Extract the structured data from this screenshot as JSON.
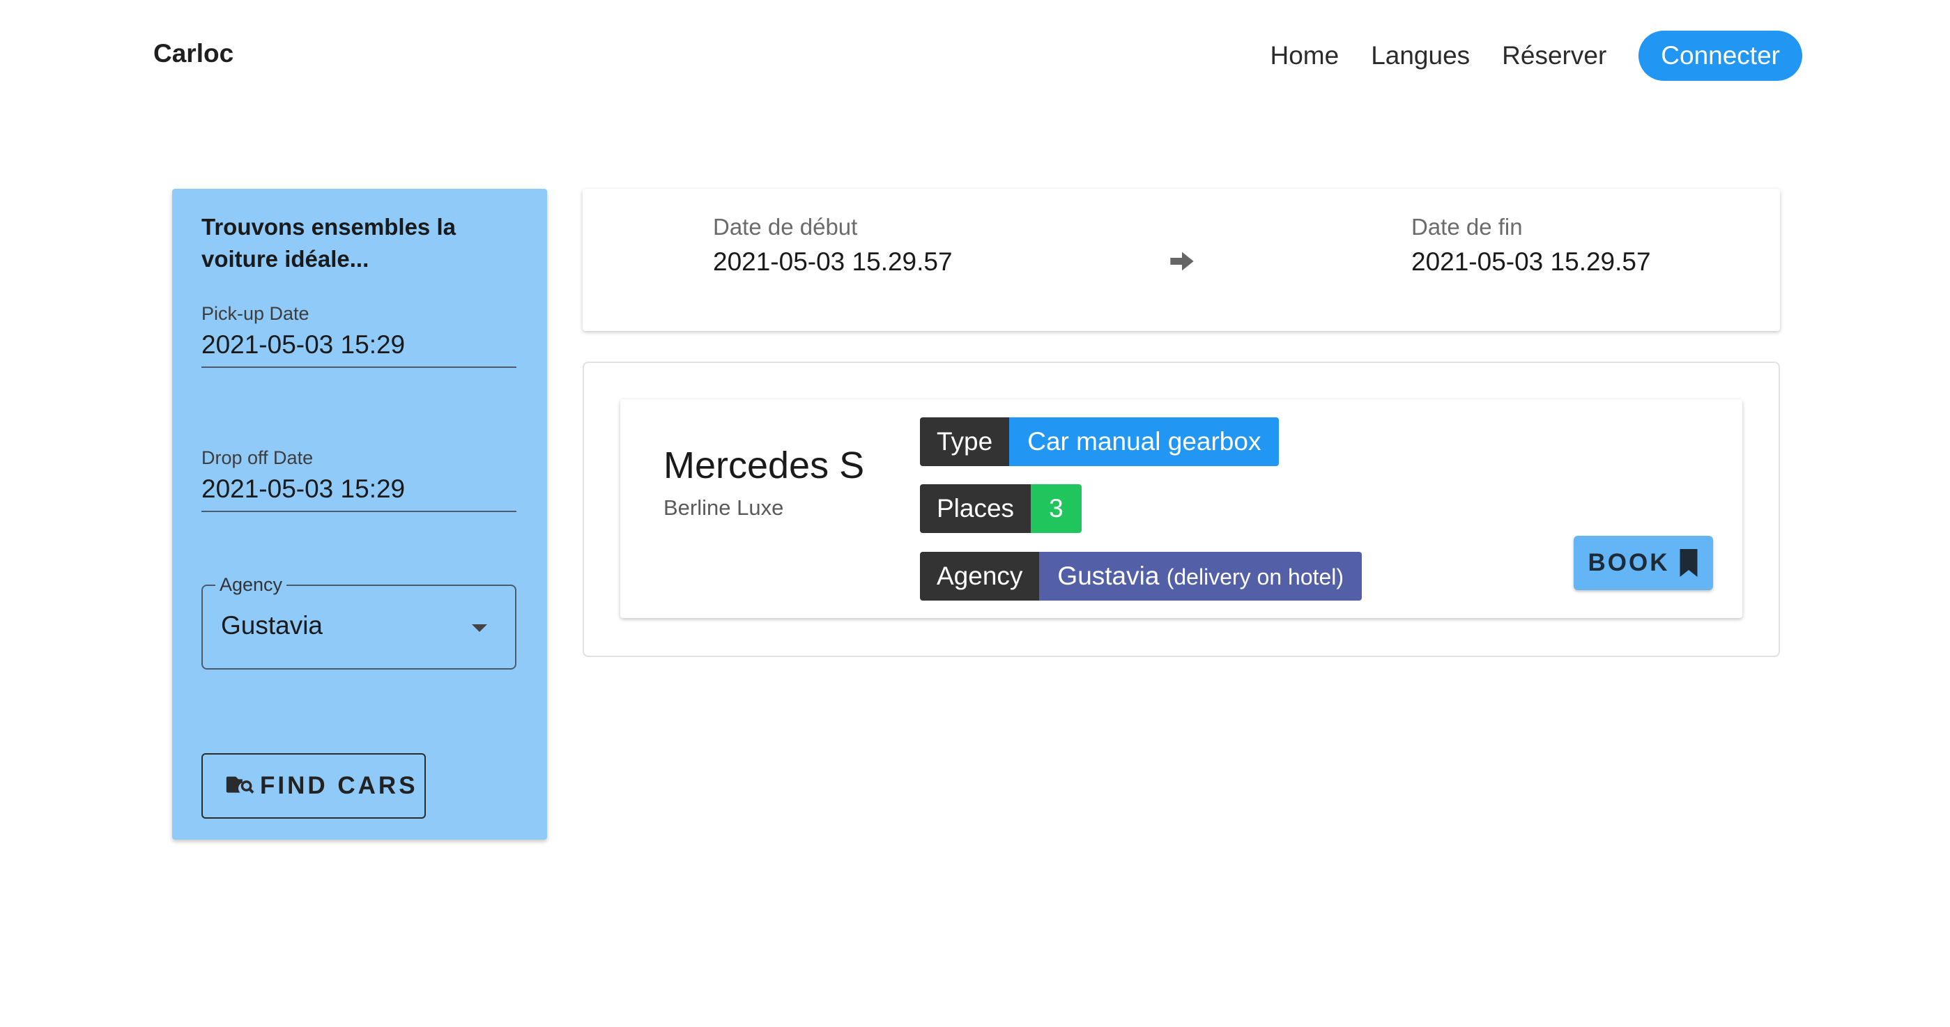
{
  "header": {
    "brand": "Carloc",
    "nav": [
      "Home",
      "Langues",
      "Réserver"
    ],
    "connect_label": "Connecter",
    "accent_color": "#2196f3"
  },
  "search": {
    "title": "Trouvons ensembles la voiture idéale...",
    "pickup_label": "Pick-up Date",
    "pickup_value": "2021-05-03 15:29",
    "dropoff_label": "Drop off Date",
    "dropoff_value": "2021-05-03 15:29",
    "agency_label": "Agency",
    "agency_value": "Gustavia",
    "find_label": "FIND CARS",
    "find_icon": "folder-search-icon",
    "panel_color": "#90caf9"
  },
  "dates": {
    "start_label": "Date de début",
    "start_value": "2021-05-03 15.29.57",
    "end_label": "Date de fin",
    "end_value": "2021-05-03 15.29.57",
    "arrow_icon": "arrow-right-icon"
  },
  "car": {
    "name": "Mercedes S",
    "category": "Berline Luxe",
    "type_key": "Type",
    "type_value": "Car manual gearbox",
    "type_color": "#2196f3",
    "places_key": "Places",
    "places_value": "3",
    "places_color": "#21c55d",
    "agency_key": "Agency",
    "agency_name": "Gustavia",
    "agency_note": "(delivery on hotel)",
    "agency_color": "#5360a8",
    "book_label": "BOOK",
    "book_icon": "bookmark-icon"
  }
}
